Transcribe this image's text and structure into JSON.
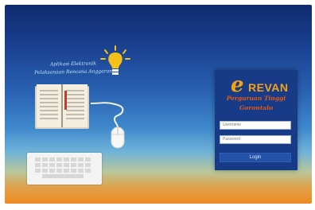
{
  "left_text": {
    "line1": "Aplikasi Elektronik",
    "line2": "Pelaksanaan Rencana Anggaran"
  },
  "brand": {
    "logo_letter": "e",
    "logo_word": "REVAN",
    "subtitle_line1": "Perguruan Tinggi",
    "subtitle_line2": "Gorontalo"
  },
  "form": {
    "username_placeholder": "Username",
    "password_placeholder": "Password",
    "login_label": "Login"
  },
  "colors": {
    "panel": "#173b86",
    "accent_orange": "#f2a30f",
    "subtitle_red": "#e05a1a"
  },
  "icons": [
    "light-bulb-icon",
    "open-book-icon",
    "mouse-icon",
    "keyboard-icon"
  ]
}
